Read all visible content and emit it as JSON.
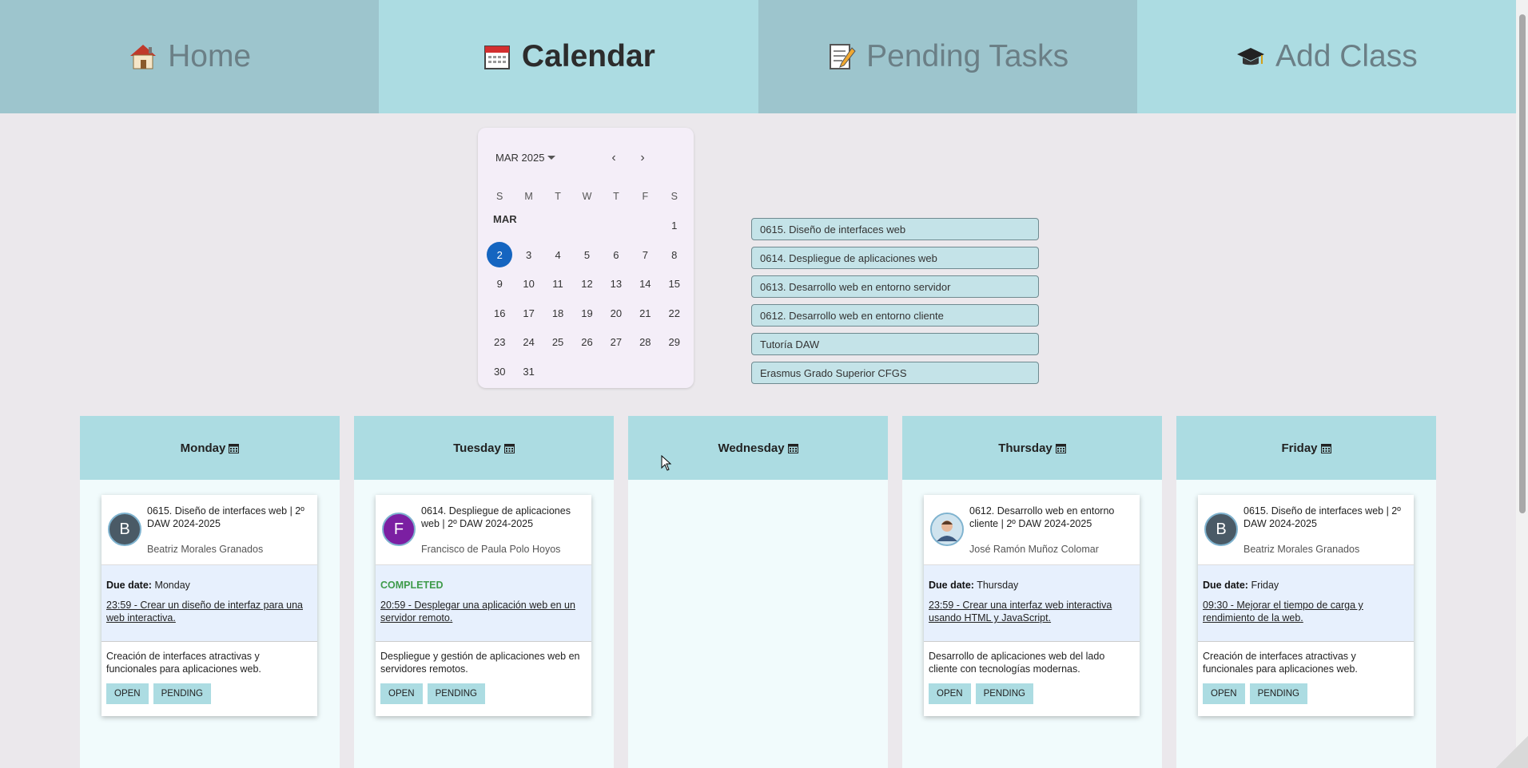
{
  "nav": {
    "tabs": [
      {
        "label": "Home",
        "icon": "house-icon"
      },
      {
        "label": "Calendar",
        "icon": "calendar-icon"
      },
      {
        "label": "Pending Tasks",
        "icon": "memo-icon"
      },
      {
        "label": "Add Class",
        "icon": "graduation-cap-icon"
      }
    ],
    "active": "Calendar"
  },
  "calendar": {
    "header": "MAR 2025",
    "month_label": "MAR",
    "weekdays": [
      "S",
      "M",
      "T",
      "W",
      "T",
      "F",
      "S"
    ],
    "selected_day": "2",
    "weeks": [
      [
        "",
        "",
        "",
        "",
        "",
        "",
        "1"
      ],
      [
        "2",
        "3",
        "4",
        "5",
        "6",
        "7",
        "8"
      ],
      [
        "9",
        "10",
        "11",
        "12",
        "13",
        "14",
        "15"
      ],
      [
        "16",
        "17",
        "18",
        "19",
        "20",
        "21",
        "22"
      ],
      [
        "23",
        "24",
        "25",
        "26",
        "27",
        "28",
        "29"
      ],
      [
        "30",
        "31",
        "",
        "",
        "",
        "",
        ""
      ]
    ]
  },
  "classes": [
    "0615. Diseño de interfaces web",
    "0614. Despliegue de aplicaciones web",
    "0613. Desarrollo web en entorno servidor",
    "0612. Desarrollo web en entorno cliente",
    "Tutoría DAW",
    "Erasmus Grado Superior CFGS"
  ],
  "days": [
    {
      "name": "Monday",
      "card": {
        "avatar_letter": "B",
        "avatar_color": "#4a5a66",
        "course": "0615. Diseño de interfaces web | 2º DAW 2024-2025",
        "teacher": "Beatriz Morales Granados",
        "due_label": "Due date:",
        "due_value": "Monday",
        "status": "",
        "task": "23:59 - Crear un diseño de interfaz para una web interactiva.",
        "description": "Creación de interfaces atractivas y funcionales para aplicaciones web.",
        "open": "OPEN",
        "pending": "PENDING"
      }
    },
    {
      "name": "Tuesday",
      "card": {
        "avatar_letter": "F",
        "avatar_color": "#7b1fa2",
        "course": "0614. Despliegue de aplicaciones web | 2º DAW 2024-2025",
        "teacher": "Francisco de Paula Polo Hoyos",
        "due_label": "",
        "due_value": "",
        "status": "COMPLETED",
        "task": "20:59 - Desplegar una aplicación web en un servidor remoto.",
        "description": "Despliegue y gestión de aplicaciones web en servidores remotos.",
        "open": "OPEN",
        "pending": "PENDING"
      }
    },
    {
      "name": "Wednesday",
      "card": null
    },
    {
      "name": "Thursday",
      "card": {
        "avatar_letter": "",
        "avatar_color": "#cfe3ee",
        "course": "0612. Desarrollo web en entorno cliente | 2º DAW 2024-2025",
        "teacher": "José Ramón Muñoz Colomar",
        "due_label": "Due date:",
        "due_value": "Thursday",
        "status": "",
        "task": "23:59 - Crear una interfaz web interactiva usando HTML y JavaScript.",
        "description": "Desarrollo de aplicaciones web del lado cliente con tecnologías modernas.",
        "open": "OPEN",
        "pending": "PENDING"
      }
    },
    {
      "name": "Friday",
      "card": {
        "avatar_letter": "B",
        "avatar_color": "#4a5a66",
        "course": "0615. Diseño de interfaces web | 2º DAW 2024-2025",
        "teacher": "Beatriz Morales Granados",
        "due_label": "Due date:",
        "due_value": "Friday",
        "status": "",
        "task": "09:30 - Mejorar el tiempo de carga y rendimiento de la web.",
        "description": "Creación de interfaces atractivas y funcionales para aplicaciones web.",
        "open": "OPEN",
        "pending": "PENDING"
      }
    }
  ]
}
